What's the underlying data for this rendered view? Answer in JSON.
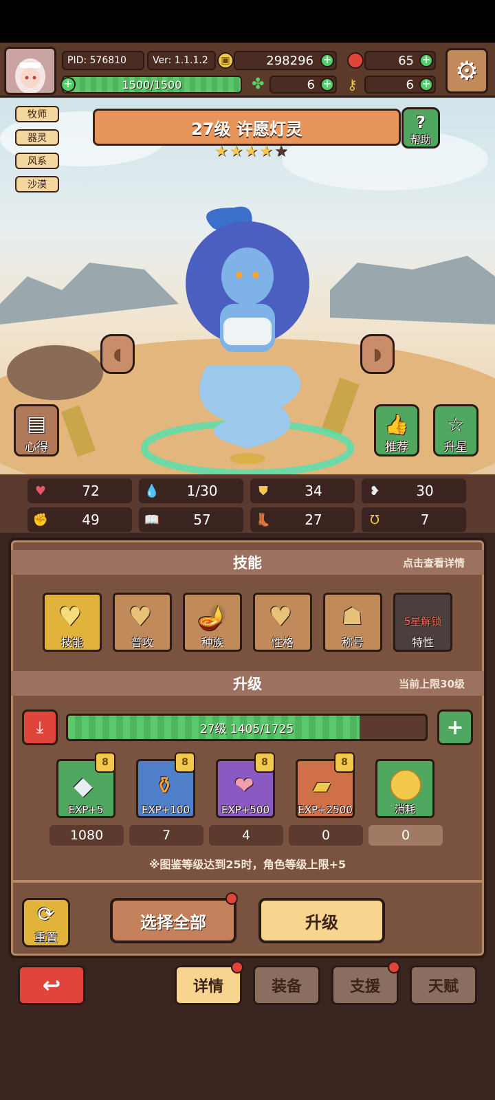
{
  "header": {
    "pid": "PID: 576810",
    "version": "Ver: 1.1.1.2",
    "gold": "298296",
    "gems": "65",
    "energy": "1500/1500",
    "clover": "6",
    "key": "6"
  },
  "character": {
    "title": "27级  许愿灯灵",
    "stars_filled": 4,
    "stars_total": 5,
    "tags": [
      "牧师",
      "器灵",
      "风系",
      "沙漠"
    ],
    "help_label": "帮助",
    "notes_label": "心得",
    "recommend_label": "推荐",
    "star_up_label": "升星"
  },
  "stats": [
    {
      "icon": "heart-icon",
      "value": "72"
    },
    {
      "icon": "water-drop-icon",
      "value": "1/30"
    },
    {
      "icon": "shield-icon",
      "value": "34"
    },
    {
      "icon": "wing-icon",
      "value": "30"
    },
    {
      "icon": "fist-icon",
      "value": "49"
    },
    {
      "icon": "book-icon",
      "value": "57"
    },
    {
      "icon": "boot-icon",
      "value": "27"
    },
    {
      "icon": "horseshoe-icon",
      "value": "7"
    }
  ],
  "skills_section": {
    "title": "技能",
    "hint": "点击查看详情",
    "items": [
      {
        "label": "技能"
      },
      {
        "label": "普攻"
      },
      {
        "label": "种族"
      },
      {
        "label": "性格"
      },
      {
        "label": "称号"
      },
      {
        "label": "特性",
        "locked_text": "5星解锁"
      }
    ]
  },
  "level_section": {
    "title": "升级",
    "hint": "当前上限30级",
    "progress_text": "27级  1405/1725",
    "progress_fraction": 0.8145,
    "items": [
      {
        "label": "EXP+5",
        "count": "1080",
        "color": "#4fa760"
      },
      {
        "label": "EXP+100",
        "count": "7",
        "color": "#4f7fc9"
      },
      {
        "label": "EXP+500",
        "count": "4",
        "color": "#8a5ac2"
      },
      {
        "label": "EXP+2500",
        "count": "0",
        "color": "#d07048"
      },
      {
        "label": "消耗",
        "count": "0",
        "color": "#4fa760"
      }
    ],
    "note": "※图鉴等级达到25时，角色等级上限+5"
  },
  "actions": {
    "reset_label": "重置",
    "select_all_label": "选择全部",
    "upgrade_label": "升级"
  },
  "tabs": [
    {
      "label": "详情",
      "active": true,
      "dot": true
    },
    {
      "label": "装备",
      "active": false,
      "dot": false
    },
    {
      "label": "支援",
      "active": false,
      "dot": true
    },
    {
      "label": "天赋",
      "active": false,
      "dot": false
    }
  ],
  "colors": {
    "gold": "#f2c94c",
    "green": "#4fd06a",
    "red_button": "#e0443a",
    "panel": "#7a5340",
    "banner": "#e8955b"
  }
}
